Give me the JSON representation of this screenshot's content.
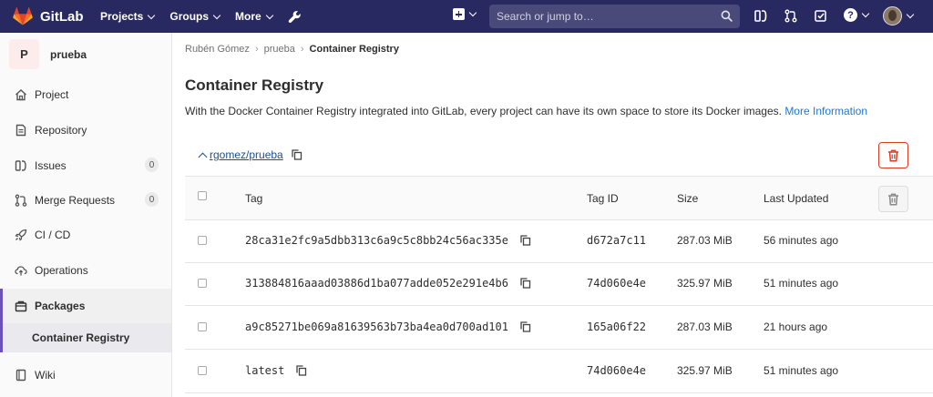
{
  "nav": {
    "brand": "GitLab",
    "items": [
      {
        "label": "Projects"
      },
      {
        "label": "Groups"
      },
      {
        "label": "More"
      }
    ],
    "search_placeholder": "Search or jump to…"
  },
  "sidebar": {
    "project_initial": "P",
    "project_name": "prueba",
    "items": [
      {
        "label": "Project",
        "icon": "home-icon"
      },
      {
        "label": "Repository",
        "icon": "document-icon"
      },
      {
        "label": "Issues",
        "icon": "issues-icon",
        "badge": "0"
      },
      {
        "label": "Merge Requests",
        "icon": "merge-request-icon",
        "badge": "0"
      },
      {
        "label": "CI / CD",
        "icon": "rocket-icon"
      },
      {
        "label": "Operations",
        "icon": "cloud-icon"
      },
      {
        "label": "Packages",
        "icon": "package-icon"
      },
      {
        "label": "Container Registry"
      },
      {
        "label": "Wiki",
        "icon": "book-icon"
      }
    ]
  },
  "breadcrumb": {
    "items": [
      "Rubén Gómez",
      "prueba",
      "Container Registry"
    ]
  },
  "page": {
    "title": "Container Registry",
    "description": "With the Docker Container Registry integrated into GitLab, every project can have its own space to store its Docker images.",
    "more_link": "More Information"
  },
  "registry": {
    "repo_name": "rgomez/prueba",
    "columns": {
      "tag": "Tag",
      "tag_id": "Tag ID",
      "size": "Size",
      "last_updated": "Last Updated"
    },
    "rows": [
      {
        "tag": "28ca31e2fc9a5dbb313c6a9c5c8bb24c56ac335e",
        "tag_id": "d672a7c11",
        "size": "287.03 MiB",
        "updated": "56 minutes ago"
      },
      {
        "tag": "313884816aaad03886d1ba077adde052e291e4b6",
        "tag_id": "74d060e4e",
        "size": "325.97 MiB",
        "updated": "51 minutes ago"
      },
      {
        "tag": "a9c85271be069a81639563b73ba4ea0d700ad101",
        "tag_id": "165a06f22",
        "size": "287.03 MiB",
        "updated": "21 hours ago"
      },
      {
        "tag": "latest",
        "tag_id": "74d060e4e",
        "size": "325.97 MiB",
        "updated": "51 minutes ago"
      }
    ]
  },
  "colors": {
    "nav_bg": "#292961",
    "link": "#1f78d1",
    "danger": "#db3b21",
    "active_border": "#6b4fbb"
  }
}
